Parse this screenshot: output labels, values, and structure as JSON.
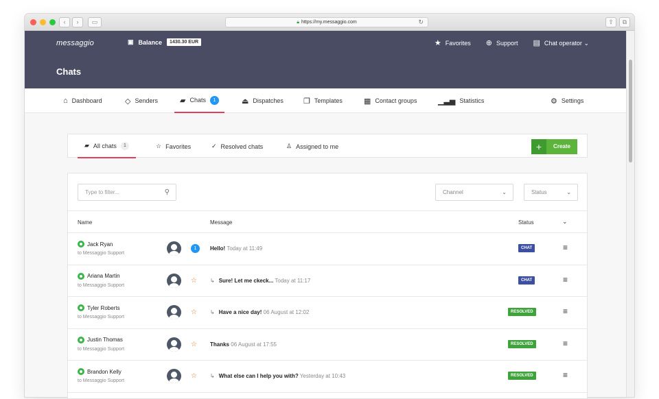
{
  "browser": {
    "url": "https://my.messaggio.com"
  },
  "app": {
    "logo": "messaggio",
    "balance_label": "Balance",
    "balance_value": "1430.30 EUR",
    "favorites": "Favorites",
    "support": "Support",
    "operator": "Chat operator",
    "page_title": "Chats"
  },
  "nav": {
    "dashboard": "Dashboard",
    "senders": "Senders",
    "chats": "Chats",
    "chats_badge": "1",
    "dispatches": "Dispatches",
    "templates": "Templates",
    "contact_groups": "Contact groups",
    "statistics": "Statistics",
    "settings": "Settings"
  },
  "tabs": {
    "all": "All chats",
    "all_count": "1",
    "favorites": "Favorites",
    "resolved": "Resolved chats",
    "assigned": "Assigned to me",
    "create": "Create"
  },
  "filters": {
    "placeholder": "Type to filter...",
    "channel": "Channel",
    "status": "Status"
  },
  "table": {
    "col_name": "Name",
    "col_message": "Message",
    "col_status": "Status",
    "rows": [
      {
        "name": "Jack Ryan",
        "sub": "to Messaggio Support",
        "unread": "1",
        "reply": false,
        "message": "Hello!",
        "time": "Today at 11:49",
        "status": "CHAT"
      },
      {
        "name": "Ariana Martin",
        "sub": "to Messaggio Support",
        "unread": "",
        "reply": true,
        "message": "Sure! Let me ckeck...",
        "time": "Today at 11:17",
        "status": "CHAT"
      },
      {
        "name": "Tyler Roberts",
        "sub": "to Messaggio Support",
        "unread": "",
        "reply": true,
        "message": "Have a nice day!",
        "time": "06 August at 12:02",
        "status": "RESOLVED"
      },
      {
        "name": "Justin Thomas",
        "sub": "to Messaggio Support",
        "unread": "",
        "reply": false,
        "message": "Thanks",
        "time": "06 August at 17:55",
        "status": "RESOLVED"
      },
      {
        "name": "Brandon Kelly",
        "sub": "to Messaggio Support",
        "unread": "",
        "reply": true,
        "message": "What else can I help you with?",
        "time": "Yesterday at 10:43",
        "status": "RESOLVED"
      }
    ]
  },
  "colors": {
    "header": "#4a4c63",
    "accent": "#e0405b",
    "chat": "#3c4fa3",
    "resolved": "#3ea33a",
    "create": "#5cb43b"
  }
}
